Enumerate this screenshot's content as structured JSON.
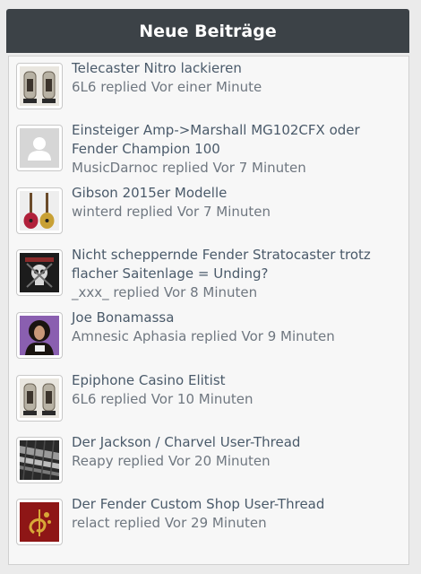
{
  "widget": {
    "title": "Neue Beiträge"
  },
  "posts": [
    {
      "title": "Telecaster Nitro lackieren",
      "user": "6L6",
      "action": "replied",
      "time": "Vor einer Minute",
      "icon": "tubes-icon"
    },
    {
      "title": "Einsteiger Amp->Marshall MG102CFX oder Fender Champion 100",
      "user": "MusicDarnoc",
      "action": "replied",
      "time": "Vor 7 Minuten",
      "icon": "default-avatar-icon"
    },
    {
      "title": "Gibson 2015er Modelle",
      "user": "winterd",
      "action": "replied",
      "time": "Vor 7 Minuten",
      "icon": "guitars-icon"
    },
    {
      "title": "Nicht scheppernde Fender Stratocaster trotz flacher Saitenlage = Unding?",
      "user": "_xxx_",
      "action": "replied",
      "time": "Vor 8 Minuten",
      "icon": "skull-icon"
    },
    {
      "title": "Joe Bonamassa",
      "user": "Amnesic Aphasia",
      "action": "replied",
      "time": "Vor 9 Minuten",
      "icon": "portrait-icon"
    },
    {
      "title": "Epiphone Casino Elitist",
      "user": "6L6",
      "action": "replied",
      "time": "Vor 10 Minuten",
      "icon": "tubes-icon"
    },
    {
      "title": "Der Jackson / Charvel User-Thread",
      "user": "Reapy",
      "action": "replied",
      "time": "Vor 20 Minuten",
      "icon": "fretboard-icon"
    },
    {
      "title": "Der Fender Custom Shop User-Thread",
      "user": "relact",
      "action": "replied",
      "time": "Vor 29 Minuten",
      "icon": "clef-icon"
    }
  ]
}
